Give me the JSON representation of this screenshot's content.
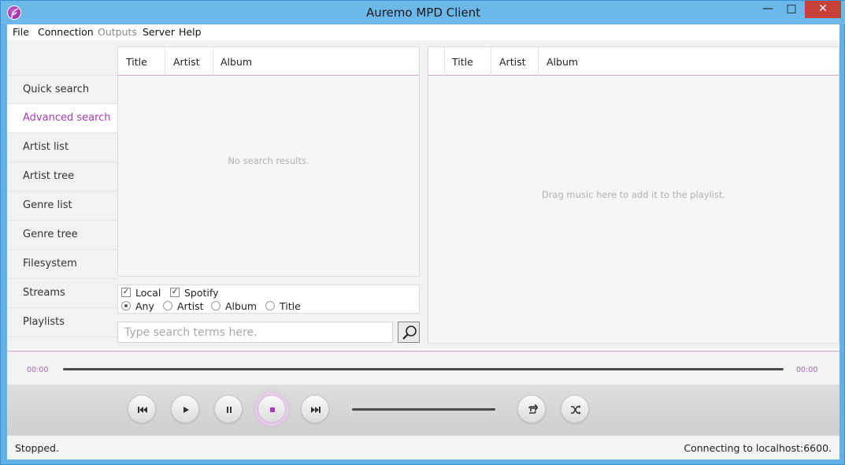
{
  "window": {
    "title": "Auremo MPD Client",
    "minimize_glyph": "—",
    "maximize_glyph": "□",
    "close_glyph": "✕"
  },
  "menu": [
    "File",
    "Connection",
    "Outputs",
    "Server",
    "Help"
  ],
  "menu_disabled": [
    "Outputs"
  ],
  "nav": {
    "items": [
      "Quick search",
      "Advanced search",
      "Artist list",
      "Artist tree",
      "Genre list",
      "Genre tree",
      "Filesystem",
      "Streams",
      "Playlists"
    ],
    "active": "Advanced search"
  },
  "search_results": {
    "columns": [
      "Title",
      "Artist",
      "Album"
    ],
    "empty_message": "No search results."
  },
  "filters": {
    "sources": [
      {
        "label": "Local",
        "checked": true
      },
      {
        "label": "Spotify",
        "checked": true
      }
    ],
    "fields": [
      {
        "label": "Any",
        "selected": true
      },
      {
        "label": "Artist",
        "selected": false
      },
      {
        "label": "Album",
        "selected": false
      },
      {
        "label": "Title",
        "selected": false
      }
    ]
  },
  "search": {
    "placeholder": "Type search terms here.",
    "button_icon": "magnifier-icon"
  },
  "playlist": {
    "columns": [
      "Title",
      "Artist",
      "Album"
    ],
    "empty_message": "Drag music here to add it to the playlist."
  },
  "playback": {
    "elapsed": "00:00",
    "remaining": "00:00",
    "progress": 0,
    "volume": 1.0,
    "buttons": [
      "previous",
      "play",
      "pause",
      "stop",
      "next",
      "repeat",
      "shuffle"
    ],
    "active_button": "stop"
  },
  "status": {
    "left": "Stopped.",
    "right": "Connecting to localhost:6600."
  },
  "colors": {
    "accent": "#a33bb5",
    "titlebar": "#6cb8ea",
    "close": "#c8403a"
  }
}
